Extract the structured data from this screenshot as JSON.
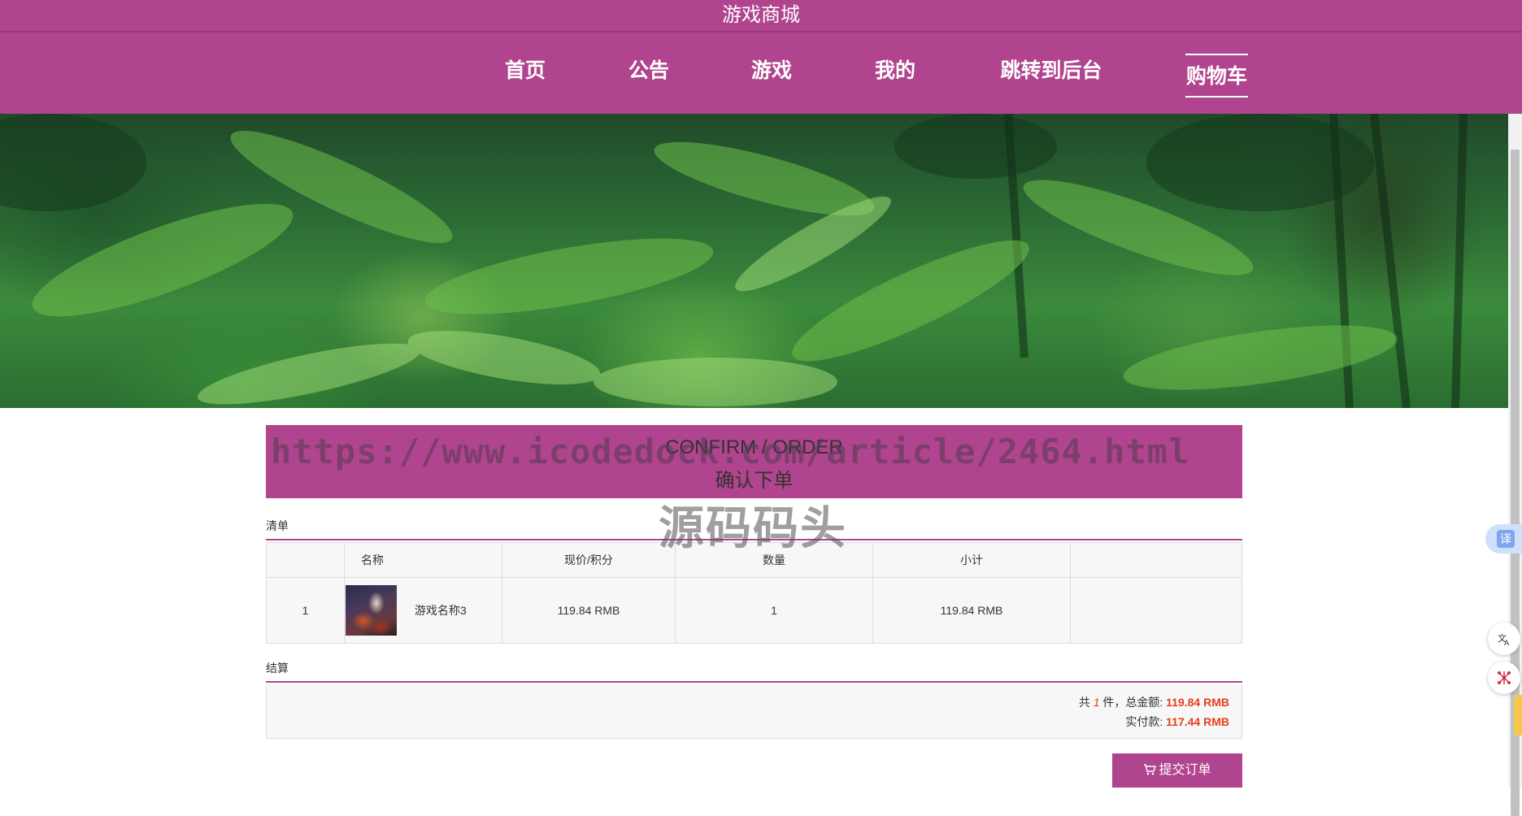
{
  "site": {
    "title": "游戏商城"
  },
  "nav": {
    "items": [
      {
        "label": "首页"
      },
      {
        "label": "公告"
      },
      {
        "label": "游戏"
      },
      {
        "label": "我的"
      },
      {
        "label": "跳转到后台"
      },
      {
        "label": "购物车",
        "active": true
      }
    ]
  },
  "watermark": {
    "url": "https://www.icodedock.com/article/2464.html",
    "text": "源码码头"
  },
  "order": {
    "title_en": "CONFIRM / ORDER",
    "title_cn": "确认下单"
  },
  "list_section": {
    "label": "清单",
    "columns": [
      "名称",
      "现价/积分",
      "数量",
      "小计"
    ],
    "rows": [
      {
        "index": "1",
        "name": "游戏名称3",
        "price": "119.84 RMB",
        "quantity": "1",
        "subtotal": "119.84 RMB"
      }
    ]
  },
  "settle_section": {
    "label": "结算",
    "line1_prefix": "共",
    "count": "1",
    "line1_mid": "件，总金额:",
    "total": "119.84 RMB",
    "line2_prefix": "实付款:",
    "paid": "117.44 RMB"
  },
  "actions": {
    "submit_label": "提交订单"
  },
  "side_widgets": {
    "translate_label": "译"
  },
  "colors": {
    "brand": "#b1448e",
    "price_red": "#e53f1a"
  }
}
